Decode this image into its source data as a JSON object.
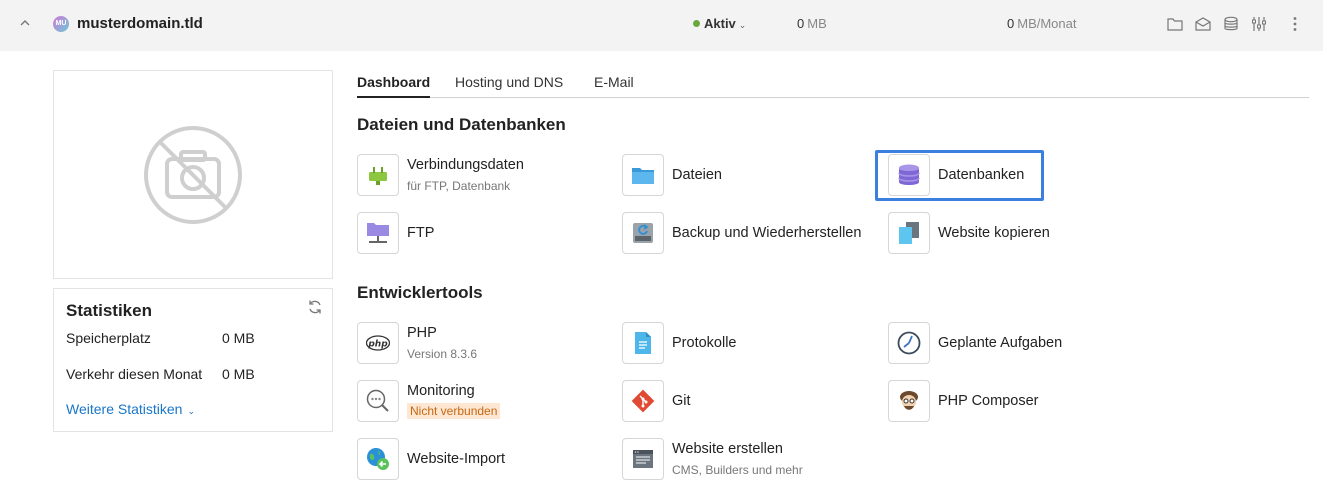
{
  "header": {
    "avatar_initials": "MU",
    "domain": "musterdomain.tld",
    "status": "Aktiv",
    "disk_value": "0",
    "disk_unit": "MB",
    "traffic_value": "0",
    "traffic_unit": "MB/Monat",
    "icons": [
      "folder-icon",
      "mail-icon",
      "database-icon",
      "sliders-icon",
      "more-vertical-icon"
    ]
  },
  "stats": {
    "title": "Statistiken",
    "rows": [
      {
        "label": "Speicherplatz",
        "value": "0 MB"
      },
      {
        "label": "Verkehr diesen Monat",
        "value": "0 MB"
      }
    ],
    "more_link": "Weitere Statistiken"
  },
  "tabs": [
    {
      "label": "Dashboard",
      "active": true
    },
    {
      "label": "Hosting und DNS",
      "active": false
    },
    {
      "label": "E-Mail",
      "active": false
    }
  ],
  "sections": {
    "files": {
      "title": "Dateien und Datenbanken",
      "tiles": [
        {
          "label": "Verbindungsdaten",
          "sub": "für FTP, Datenbank",
          "icon": "plug-icon"
        },
        {
          "label": "Dateien",
          "icon": "folder-icon"
        },
        {
          "label": "Datenbanken",
          "icon": "database-icon"
        },
        {
          "label": "FTP",
          "icon": "ftp-icon"
        },
        {
          "label": "Backup und Wiederherstellen",
          "icon": "backup-icon"
        },
        {
          "label": "Website kopieren",
          "icon": "copy-icon"
        }
      ]
    },
    "dev": {
      "title": "Entwicklertools",
      "tiles": [
        {
          "label": "PHP",
          "sub": "Version 8.3.6",
          "icon": "php-icon"
        },
        {
          "label": "Protokolle",
          "icon": "log-icon"
        },
        {
          "label": "Geplante Aufgaben",
          "icon": "clock-icon"
        },
        {
          "label": "Monitoring",
          "warn": "Nicht verbunden",
          "icon": "monitoring-icon"
        },
        {
          "label": "Git",
          "icon": "git-icon"
        },
        {
          "label": "PHP Composer",
          "icon": "composer-icon"
        },
        {
          "label": "Website-Import",
          "icon": "import-icon"
        },
        {
          "label": "Website erstellen",
          "sub": "CMS, Builders und mehr",
          "icon": "website-builder-icon"
        }
      ]
    }
  },
  "colors": {
    "accent": "#3c80df",
    "link": "#1a76c7",
    "status_dot": "#6aa83b",
    "warn_text": "#c66812",
    "warn_bg": "#fde7d3"
  }
}
